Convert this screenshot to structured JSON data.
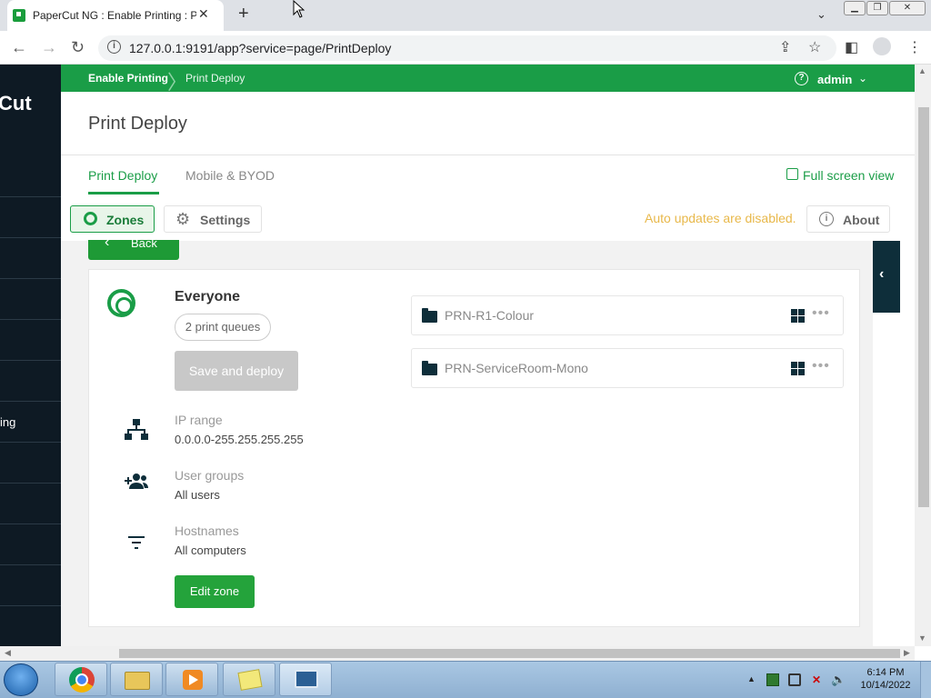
{
  "browser": {
    "tab_title": "PaperCut NG : Enable Printing : P",
    "url": "127.0.0.1:9191/app?service=page/PrintDeploy"
  },
  "sidebar": {
    "brand": "Cut",
    "active_item": "ing"
  },
  "header": {
    "breadcrumb": [
      "Enable Printing",
      "Print Deploy"
    ],
    "user": "admin"
  },
  "page": {
    "title": "Print Deploy",
    "tabs": [
      "Print Deploy",
      "Mobile & BYOD"
    ],
    "active_tab": "Print Deploy",
    "fullscreen_label": "Full screen view"
  },
  "toolbar": {
    "zones_label": "Zones",
    "settings_label": "Settings",
    "auto_updates_text": "Auto updates are disabled.",
    "about_label": "About",
    "back_label": "Back"
  },
  "zone": {
    "name": "Everyone",
    "queues_pill": "2 print queues",
    "save_label": "Save and deploy",
    "ip_range_label": "IP range",
    "ip_range_value": "0.0.0.0-255.255.255.255",
    "user_groups_label": "User groups",
    "user_groups_value": "All users",
    "hostnames_label": "Hostnames",
    "hostnames_value": "All computers",
    "edit_label": "Edit zone",
    "printers": [
      {
        "name": "PRN-R1-Colour"
      },
      {
        "name": "PRN-ServiceRoom-Mono"
      }
    ]
  },
  "taskbar": {
    "time": "6:14 PM",
    "date": "10/14/2022"
  },
  "colors": {
    "brand_green": "#1a9d47",
    "sidebar_dark": "#0e1a24",
    "warning": "#e8b84a"
  }
}
